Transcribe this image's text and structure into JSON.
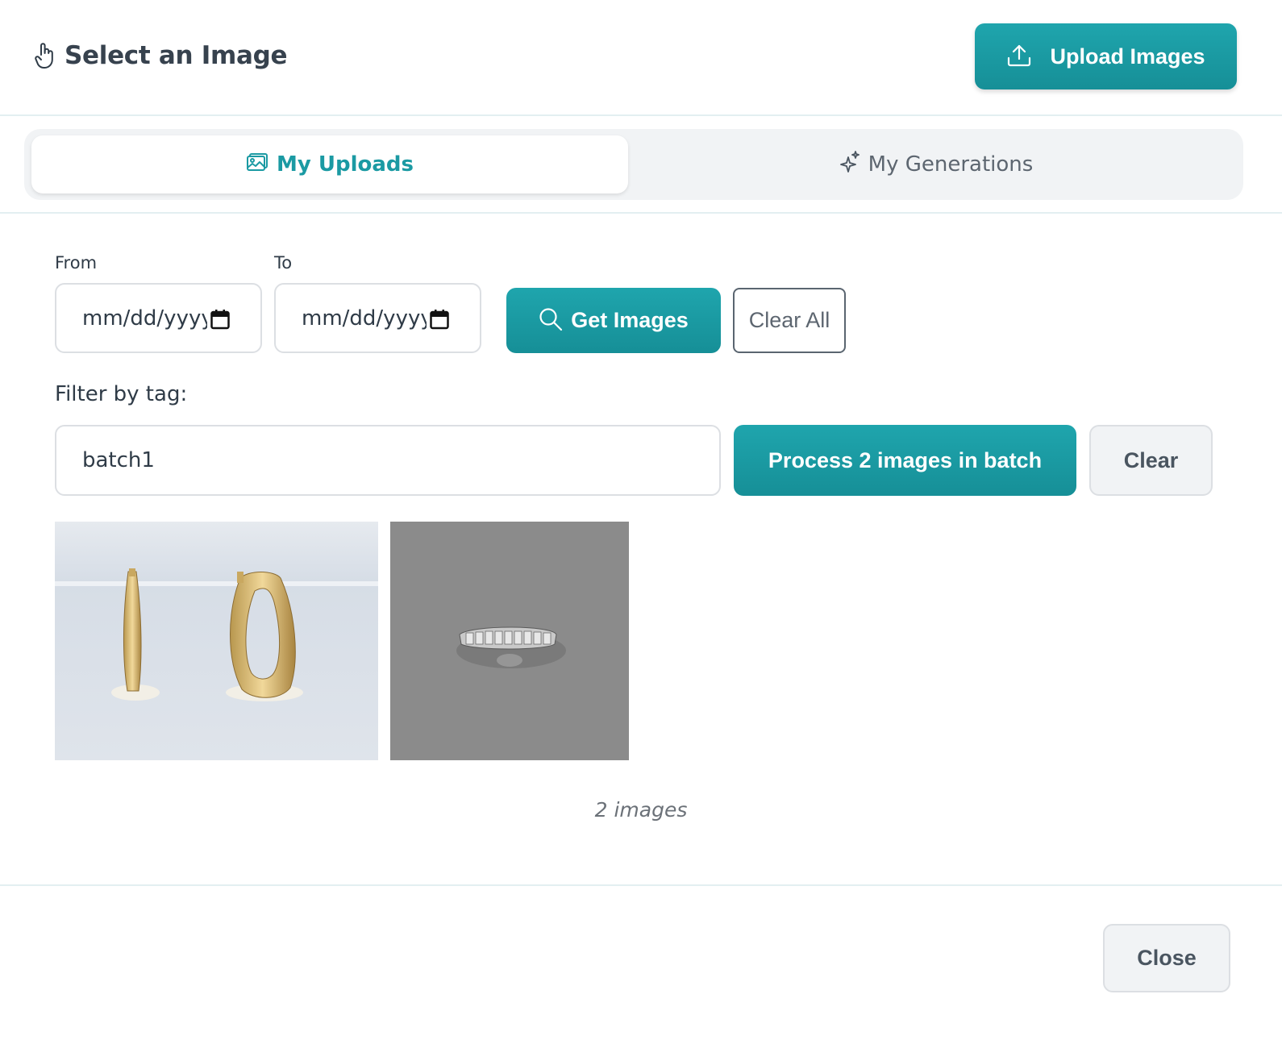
{
  "header": {
    "title": "Select an Image",
    "title_icon": "pointer-hand-icon",
    "upload_button_label": "Upload Images",
    "upload_icon": "upload-icon"
  },
  "tabs": [
    {
      "label": "My Uploads",
      "icon": "image-icon",
      "active": true
    },
    {
      "label": "My Generations",
      "icon": "sparkles-icon",
      "active": false
    }
  ],
  "filters": {
    "from_label": "From",
    "to_label": "To",
    "from_value": "mm/dd/yyyy",
    "to_value": "mm/dd/yyyy",
    "get_images_label": "Get Images",
    "clear_all_label": "Clear All",
    "filter_tag_label": "Filter by tag:",
    "tag_value": "batch1",
    "process_label": "Process 2 images in batch",
    "clear_label": "Clear"
  },
  "gallery": {
    "images": [
      {
        "alt": "gold hoop earrings"
      },
      {
        "alt": "silver baguette ring"
      }
    ],
    "count_text": "2 images"
  },
  "footer": {
    "close_label": "Close"
  },
  "colors": {
    "accent": "#1b9aa3",
    "button_gradient_top": "#1fa5ad",
    "button_gradient_bottom": "#168f97"
  }
}
